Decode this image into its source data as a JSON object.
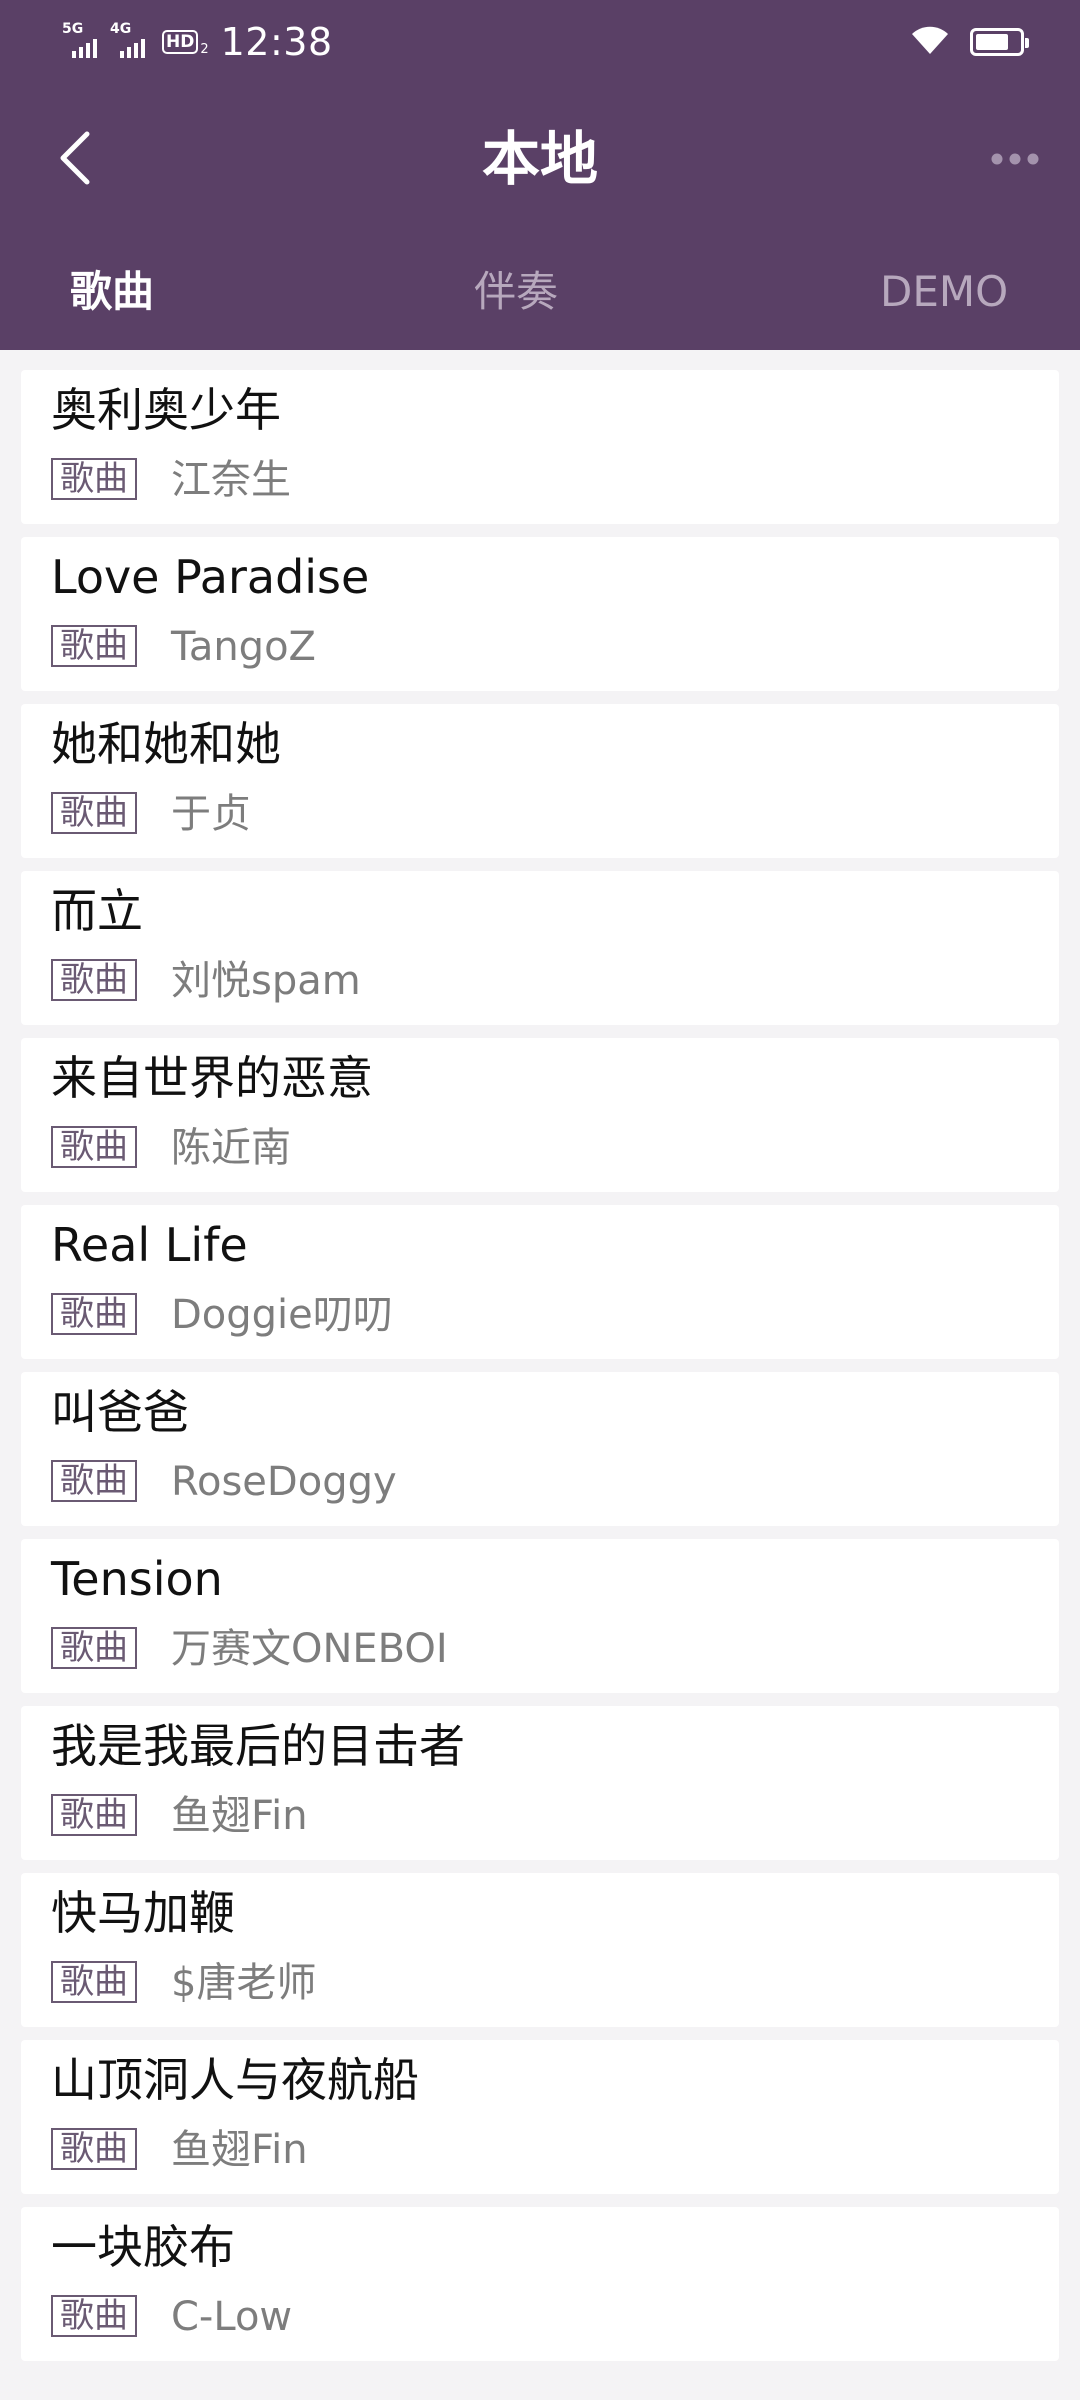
{
  "status_bar": {
    "sim1_label": "5G",
    "sim2_label": "4G",
    "hd_label": "HD",
    "hd_sub": "2",
    "time": "12:38",
    "battery_level": 0.75,
    "icons": [
      "signal-icon",
      "wifi-icon",
      "battery-icon"
    ]
  },
  "nav": {
    "title": "本地",
    "back_icon": "chevron-left-icon",
    "more_icon": "more-dots-icon"
  },
  "tabs": [
    {
      "label": "歌曲",
      "active": true
    },
    {
      "label": "伴奏",
      "active": false
    },
    {
      "label": "DEMO",
      "active": false
    }
  ],
  "colors": {
    "header_bg": "#5a4066",
    "page_bg": "#f4f3f5",
    "tag_border": "#6a5a73"
  },
  "songs": [
    {
      "title": "奥利奥少年",
      "tag": "歌曲",
      "artist": "江奈生"
    },
    {
      "title": "Love Paradise",
      "tag": "歌曲",
      "artist": "TangoZ"
    },
    {
      "title": "她和她和她",
      "tag": "歌曲",
      "artist": "于贞"
    },
    {
      "title": "而立",
      "tag": "歌曲",
      "artist": "刘悦spam"
    },
    {
      "title": "来自世界的恶意",
      "tag": "歌曲",
      "artist": "陈近南"
    },
    {
      "title": "Real Life",
      "tag": "歌曲",
      "artist": "Doggie叨叨"
    },
    {
      "title": "叫爸爸",
      "tag": "歌曲",
      "artist": "RoseDoggy"
    },
    {
      "title": "Tension",
      "tag": "歌曲",
      "artist": "万赛文ONEBOI"
    },
    {
      "title": "我是我最后的目击者",
      "tag": "歌曲",
      "artist": "鱼翅Fin"
    },
    {
      "title": "快马加鞭",
      "tag": "歌曲",
      "artist": "$唐老师"
    },
    {
      "title": "山顶洞人与夜航船",
      "tag": "歌曲",
      "artist": "鱼翅Fin"
    },
    {
      "title": "一块胶布",
      "tag": "歌曲",
      "artist": "C-Low"
    }
  ]
}
